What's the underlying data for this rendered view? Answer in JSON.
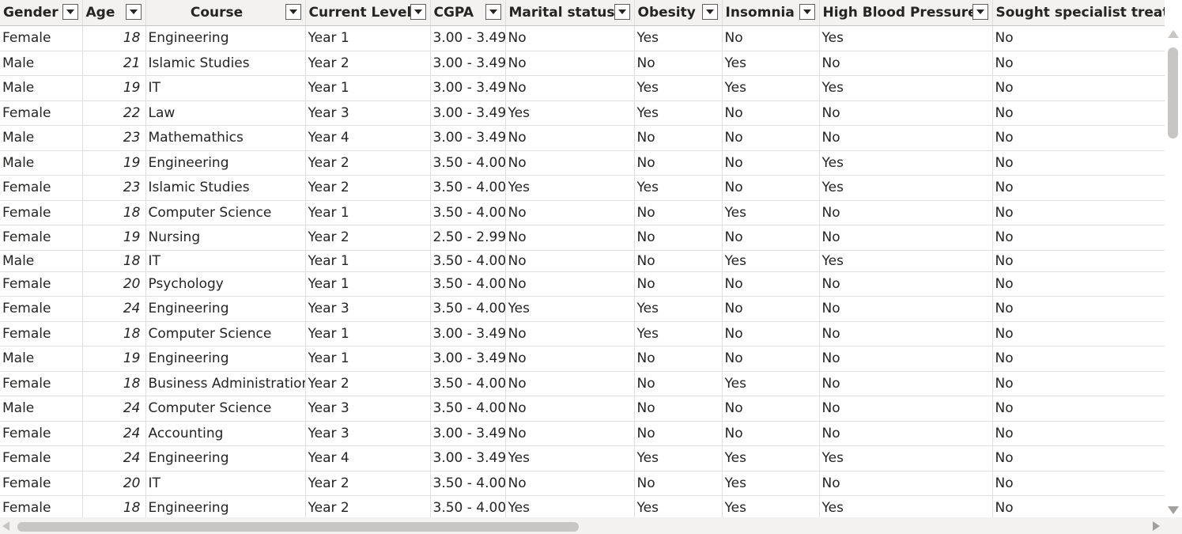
{
  "columns": [
    {
      "key": "gender",
      "label": "Gender"
    },
    {
      "key": "age",
      "label": "Age"
    },
    {
      "key": "course",
      "label": "Course"
    },
    {
      "key": "level",
      "label": "Current Level"
    },
    {
      "key": "cgpa",
      "label": "CGPA"
    },
    {
      "key": "marital",
      "label": "Marital status"
    },
    {
      "key": "obesity",
      "label": "Obesity"
    },
    {
      "key": "insomnia",
      "label": "Insomnia"
    },
    {
      "key": "bp",
      "label": "High Blood Pressure"
    },
    {
      "key": "specialist",
      "label": "Sought specialist treatment"
    }
  ],
  "rows": [
    [
      "Female",
      "18",
      "Engineering",
      "Year 1",
      "3.00 - 3.49",
      "No",
      "Yes",
      "No",
      "Yes",
      "No"
    ],
    [
      "Male",
      "21",
      "Islamic Studies",
      "Year 2",
      "3.00 - 3.49",
      "No",
      "No",
      "Yes",
      "No",
      "No"
    ],
    [
      "Male",
      "19",
      "IT",
      "Year 1",
      "3.00 - 3.49",
      "No",
      "Yes",
      "Yes",
      "Yes",
      "No"
    ],
    [
      "Female",
      "22",
      "Law",
      "Year 3",
      "3.00 - 3.49",
      "Yes",
      "Yes",
      "No",
      "No",
      "No"
    ],
    [
      "Male",
      "23",
      "Mathemathics",
      "Year 4",
      "3.00 - 3.49",
      "No",
      "No",
      "No",
      "No",
      "No"
    ],
    [
      "Male",
      "19",
      "Engineering",
      "Year 2",
      "3.50 - 4.00",
      "No",
      "No",
      "No",
      "Yes",
      "No"
    ],
    [
      "Female",
      "23",
      "Islamic Studies",
      "Year 2",
      "3.50 - 4.00",
      "Yes",
      "Yes",
      "No",
      "Yes",
      "No"
    ],
    [
      "Female",
      "18",
      "Computer Science",
      "Year 1",
      "3.50 - 4.00",
      "No",
      "No",
      "Yes",
      "No",
      "No"
    ],
    [
      "Female",
      "19",
      "Nursing",
      "Year 2",
      "2.50 - 2.99",
      "No",
      "No",
      "No",
      "No",
      "No"
    ],
    [
      "Male",
      "18",
      "IT",
      "Year 1",
      "3.50 - 4.00",
      "No",
      "No",
      "Yes",
      "Yes",
      "No"
    ],
    [
      "Female",
      "20",
      "Psychology",
      "Year 1",
      "3.50 - 4.00",
      "No",
      "No",
      "No",
      "No",
      "No"
    ],
    [
      "Female",
      "24",
      "Engineering",
      "Year 3",
      "3.50 - 4.00",
      "Yes",
      "Yes",
      "No",
      "No",
      "No"
    ],
    [
      "Female",
      "18",
      "Computer Science",
      "Year 1",
      "3.00 - 3.49",
      "No",
      "Yes",
      "No",
      "No",
      "No"
    ],
    [
      "Male",
      "19",
      "Engineering",
      "Year 1",
      "3.00 - 3.49",
      "No",
      "No",
      "No",
      "No",
      "No"
    ],
    [
      "Female",
      "18",
      "Business Administration",
      "Year 2",
      "3.50 - 4.00",
      "No",
      "No",
      "Yes",
      "No",
      "No"
    ],
    [
      "Male",
      "24",
      "Computer Science",
      "Year 3",
      "3.50 - 4.00",
      "No",
      "No",
      "No",
      "No",
      "No"
    ],
    [
      "Female",
      "24",
      "Accounting",
      "Year 3",
      "3.00 - 3.49",
      "No",
      "No",
      "No",
      "No",
      "No"
    ],
    [
      "Female",
      "24",
      "Engineering",
      "Year 4",
      "3.00 - 3.49",
      "Yes",
      "Yes",
      "Yes",
      "Yes",
      "No"
    ],
    [
      "Female",
      "20",
      "IT",
      "Year 2",
      "3.50 - 4.00",
      "No",
      "No",
      "Yes",
      "No",
      "No"
    ],
    [
      "Female",
      "18",
      "Engineering",
      "Year 2",
      "3.50 - 4.00",
      "Yes",
      "Yes",
      "Yes",
      "Yes",
      "No"
    ]
  ]
}
